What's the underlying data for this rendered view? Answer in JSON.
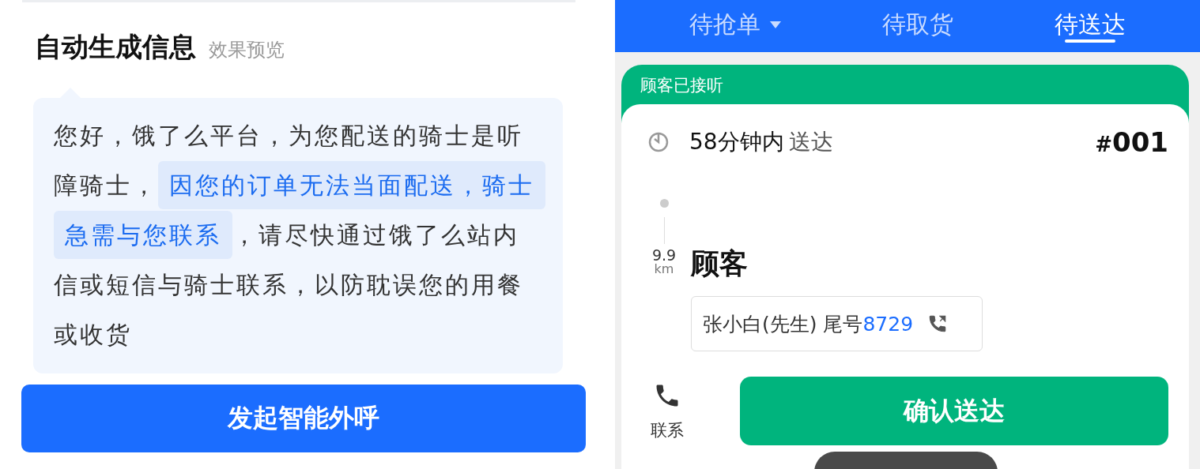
{
  "preview": {
    "title": "自动生成信息",
    "subtitle": "效果预览",
    "message": [
      {
        "text": "您好，饿了么平台，为您配送的骑士是听障骑士，",
        "highlighted": false
      },
      {
        "text": "因您的订单无法当面配送，骑士急需与您联系",
        "highlighted": true
      },
      {
        "text": "，请尽快通过饿了么站内信或短信与骑士联系，以防耽误您的用餐或收货",
        "highlighted": false
      }
    ],
    "button": "发起智能外呼"
  },
  "tabs": [
    {
      "label": "待抢单",
      "selected": false,
      "dropdown": true
    },
    {
      "label": "待取货",
      "selected": false,
      "dropdown": false
    },
    {
      "label": "待送达",
      "selected": true,
      "dropdown": false
    }
  ],
  "order": {
    "status": "顾客已接听",
    "time": "58分钟内",
    "time_suffix": "送达",
    "number_sign": "#",
    "number": "001",
    "distance": "9.9",
    "distance_unit": "km",
    "destination": "顾客",
    "contact_name": "张小白(先生) 尾号",
    "contact_digits": "8729",
    "contact_label": "联系",
    "confirm_button": "确认送达"
  }
}
